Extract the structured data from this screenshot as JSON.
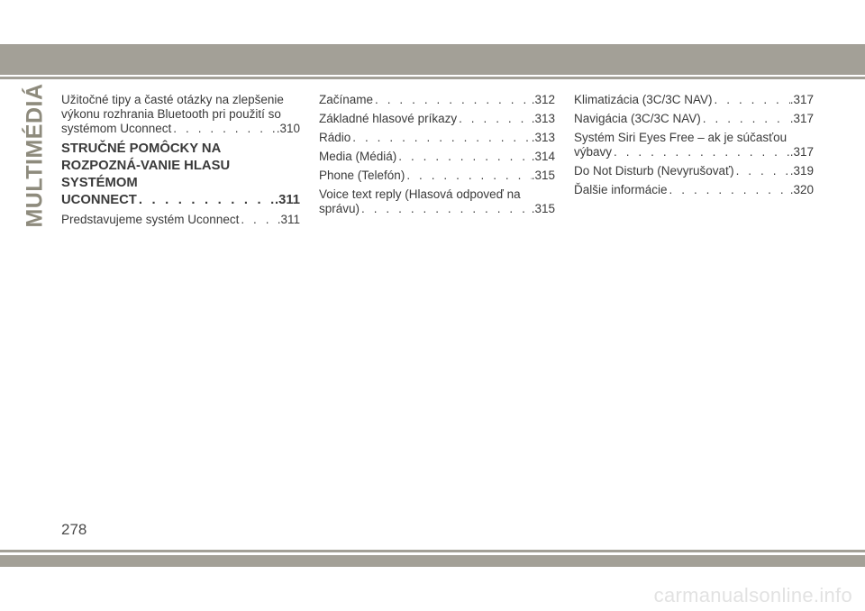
{
  "side_tab": {
    "label": "MULTIMÉDIÁ"
  },
  "columns": [
    {
      "items": [
        {
          "kind": "entry",
          "lines": [
            "Užitočné tipy a časté otázky na zlepšenie",
            "výkonu rozhrania Bluetooth pri použití so"
          ],
          "last": "systémom Uconnect",
          "page": ".310"
        },
        {
          "kind": "heading",
          "lines": [
            "STRUČNÉ POMÔCKY NA ROZPOZNÁ-",
            "VANIE HLASU SYSTÉMOM"
          ],
          "last": "UCONNECT",
          "page": ".311"
        },
        {
          "kind": "entry",
          "lines": [],
          "last": "Predstavujeme systém Uconnect",
          "page": ".311"
        }
      ]
    },
    {
      "items": [
        {
          "kind": "entry",
          "lines": [],
          "last": "Začíname",
          "page": ".312"
        },
        {
          "kind": "entry",
          "lines": [],
          "last": "Základné hlasové príkazy",
          "page": ".313"
        },
        {
          "kind": "entry",
          "lines": [],
          "last": "Rádio",
          "page": ".313"
        },
        {
          "kind": "entry",
          "lines": [],
          "last": "Media (Médiá)",
          "page": ".314"
        },
        {
          "kind": "entry",
          "lines": [],
          "last": "Phone (Telefón)",
          "page": ".315"
        },
        {
          "kind": "entry",
          "lines": [
            "Voice text reply (Hlasová odpoveď na"
          ],
          "last": "správu)",
          "page": ".315"
        }
      ]
    },
    {
      "items": [
        {
          "kind": "entry",
          "lines": [],
          "last": "Klimatizácia (3C/3C NAV)",
          "page": ".317"
        },
        {
          "kind": "entry",
          "lines": [],
          "last": "Navigácia (3C/3C NAV)",
          "page": ".317"
        },
        {
          "kind": "entry",
          "lines": [
            "Systém Siri Eyes Free – ak je súčasťou"
          ],
          "last": "výbavy",
          "page": ".317"
        },
        {
          "kind": "entry",
          "lines": [],
          "last": "Do Not Disturb (Nevyrušovať)",
          "page": ".319"
        },
        {
          "kind": "entry",
          "lines": [],
          "last": "Ďalšie informácie",
          "page": ".320"
        }
      ]
    }
  ],
  "page_number": "278",
  "watermark": "carmanualsonline.info"
}
